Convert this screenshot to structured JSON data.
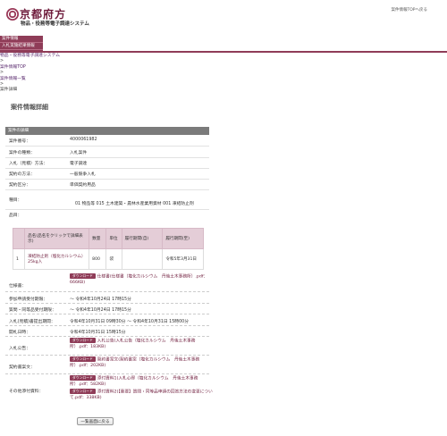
{
  "header": {
    "logo": "京都府方",
    "system_name": "物品・役務等電子調達システム",
    "top_link": "案件情報TOPへ戻る"
  },
  "menu": {
    "items": [
      "案件情報",
      "入札実施結果情報"
    ]
  },
  "breadcrumb": {
    "items": [
      {
        "label": "物品・役務等電子調達システム",
        "link": true
      },
      {
        "label": ">",
        "link": false
      },
      {
        "label": "案件情報TOP",
        "link": true
      },
      {
        "label": ">",
        "link": false
      },
      {
        "label": "案件情報一覧",
        "link": true
      },
      {
        "label": ">",
        "link": false
      },
      {
        "label": "案件詳細",
        "link": false
      }
    ]
  },
  "page_title": "案件情報詳細",
  "section": {
    "title": "案件の詳細",
    "case_number": {
      "label": "案件番号：",
      "value": "4000061982"
    },
    "case_type": {
      "label": "案件の種類：",
      "value": "入札案件"
    },
    "bid_method": {
      "label": "入札（見積）方法：",
      "value": "電子調達"
    },
    "contract_method": {
      "label": "契約の方法：",
      "value": "一般競争入札"
    },
    "contract_category": {
      "label": "契約区分：",
      "value": "単価契約用品"
    },
    "category": {
      "label": "種目：",
      "value": "01 物品等 015 土木建築・農林水産業用資材 001 凍結防止剤"
    },
    "items_label": "品目："
  },
  "items_table": {
    "headers": [
      "品名(品名をクリックで詳細表示)",
      "数量",
      "単位",
      "履行期間(自)",
      "履行期間(至)"
    ],
    "rows": [
      {
        "no": "1",
        "name": "凍結防止剤（塩化カルシウム）25kg入",
        "qty": "800",
        "unit": "袋",
        "from": "",
        "to": "令和5年3月31日"
      }
    ]
  },
  "details": {
    "spec": {
      "label": "仕様書：",
      "badge": "ダウンロード",
      "text": "仕様書(仕様書（塩化カルシウム　丹後土木事務所）.pdf：666KB)"
    },
    "apply_deadline": {
      "label": "参加申請受付期限：",
      "value": "～ 令和4年10月24日 17時15分"
    },
    "question_deadline": {
      "label": "質問・同等品受付期限：",
      "value": "～ 令和4年10月24日 17時15分"
    },
    "bid_period": {
      "label": "入札(見積)書提出期間：",
      "value": "令和4年10月31日 09時30分 ～ 令和4年10月31日 15時00分"
    },
    "opening_date": {
      "label": "開札日時：",
      "value": "令和4年10月31日 15時15分"
    },
    "bid_notice": {
      "label": "入札公告：",
      "badge": "ダウンロード",
      "text": "入札公告(入札公告（塩化カルシウム　丹後土木事務所）.pdf：183KB)"
    },
    "contract_draft": {
      "label": "契約書案文：",
      "badge": "ダウンロード",
      "text": "契約書案文(契約書案（塩化カルシウム　丹後土木事務所）.pdf：202KB)"
    },
    "other_docs": {
      "label": "その他添付資料：",
      "files": [
        {
          "badge": "ダウンロード",
          "text": "添付資料1(入札心得（塩化カルシウム　丹後土木事務所）.pdf：582KB)"
        },
        {
          "badge": "ダウンロード",
          "text": "添付資料2(【重要】質問・同等品申請の回答方法の変更について.pdf：338KB)"
        }
      ]
    }
  },
  "back_button": "一覧画面に戻る"
}
